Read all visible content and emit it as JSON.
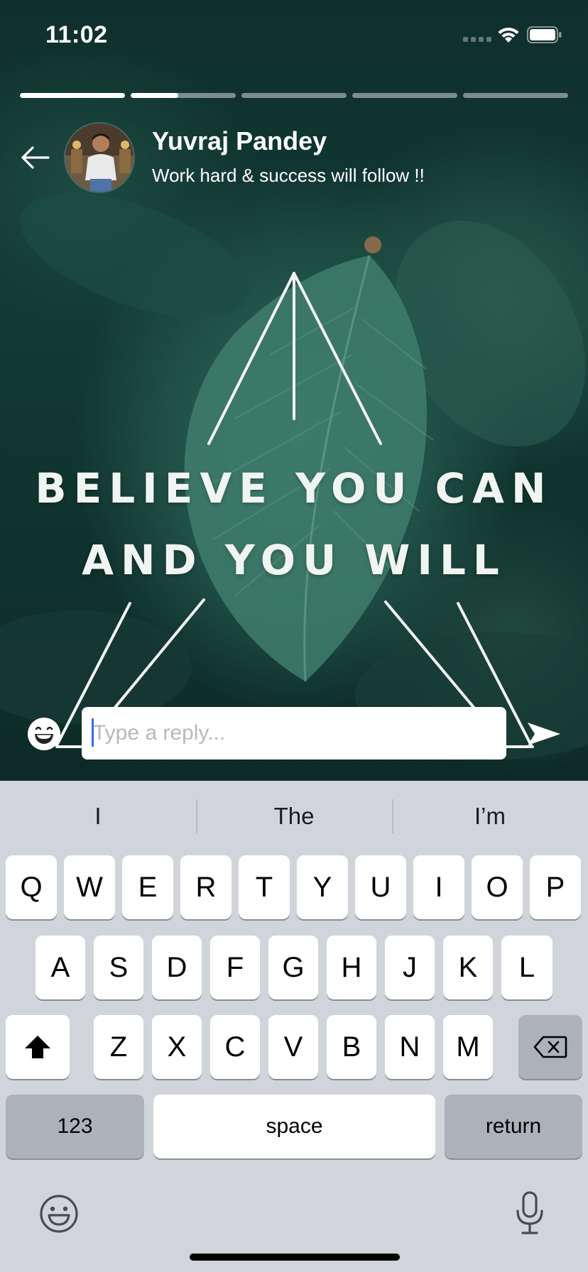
{
  "status_bar": {
    "time": "11:02"
  },
  "story": {
    "progress": [
      1.0,
      0.45,
      0.0,
      0.0,
      0.0
    ],
    "user_name": "Yuvraj Pandey",
    "user_status": "Work hard & success will follow !!",
    "quote_line_1": "BELIEVE YOU CAN",
    "quote_line_2": "AND YOU WILL"
  },
  "reply": {
    "placeholder": "Type a reply..."
  },
  "keyboard": {
    "suggestions": [
      "I",
      "The",
      "I’m"
    ],
    "row1": [
      "Q",
      "W",
      "E",
      "R",
      "T",
      "Y",
      "U",
      "I",
      "O",
      "P"
    ],
    "row2": [
      "A",
      "S",
      "D",
      "F",
      "G",
      "H",
      "J",
      "K",
      "L"
    ],
    "row3": [
      "Z",
      "X",
      "C",
      "V",
      "B",
      "N",
      "M"
    ],
    "numbers_label": "123",
    "space_label": "space",
    "return_label": "return"
  },
  "colors": {
    "keyboard_bg": "#d1d5db",
    "key": "#ffffff",
    "key_dark": "#acb1ba",
    "caret": "#3b6fe0"
  }
}
